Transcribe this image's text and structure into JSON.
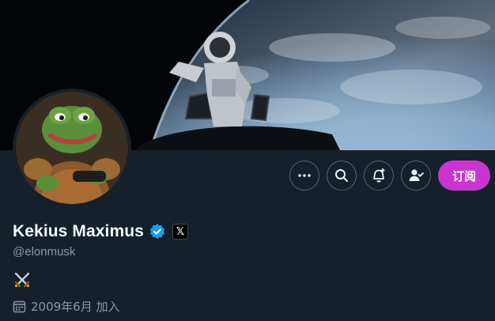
{
  "banner": {
    "description_icon": "astronaut-earth-banner"
  },
  "profile": {
    "display_name": "Kekius Maximus",
    "handle": "@elonmusk",
    "verified_icon": "verified-badge-icon",
    "affiliate_label": "𝕏",
    "bio_emoji": "⚔️",
    "joined_text": "2009年6月 加入"
  },
  "actions": {
    "more_icon": "more-icon",
    "search_icon": "search-icon",
    "notify_icon": "notification-bell-icon",
    "follow_icon": "following-icon",
    "subscribe_label": "订阅"
  },
  "colors": {
    "background": "#15202b",
    "subscribe": "#c936cf",
    "verified": "#1d9bf0",
    "muted_text": "#8b98a5"
  }
}
